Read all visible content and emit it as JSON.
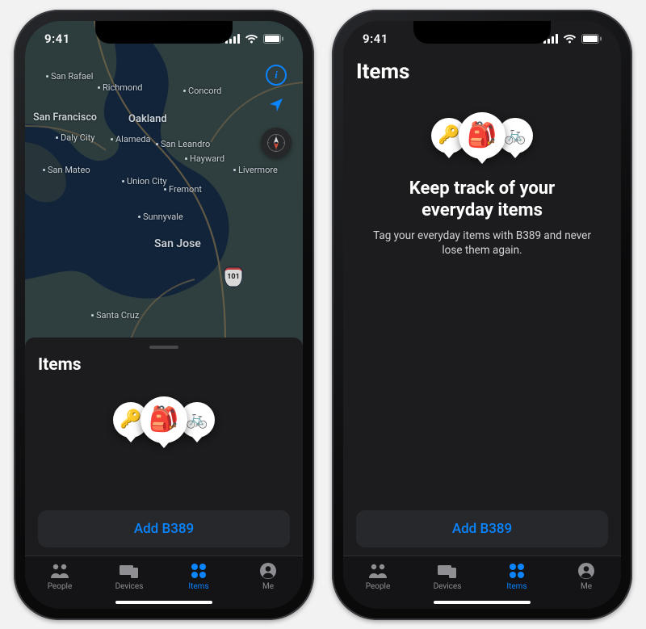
{
  "status": {
    "time": "9:41"
  },
  "map": {
    "labels": {
      "san_rafael": "San Rafael",
      "richmond": "Richmond",
      "concord": "Concord",
      "san_francisco": "San Francisco",
      "oakland": "Oakland",
      "daly_city": "Daly City",
      "alameda": "Alameda",
      "san_leandro": "San Leandro",
      "hayward": "Hayward",
      "san_mateo": "San Mateo",
      "union_city": "Union City",
      "fremont": "Fremont",
      "livermore": "Livermore",
      "sunnyvale": "Sunnyvale",
      "san_jose": "San Jose",
      "santa_cruz": "Santa Cruz"
    },
    "highway_101": "101"
  },
  "left": {
    "sheet_title": "Items",
    "add_button": "Add B389"
  },
  "right": {
    "sheet_title": "Items",
    "icons": {
      "key": "🔑",
      "backpack": "🎒",
      "bike": "🚲"
    },
    "headline_line1": "Keep track of your",
    "headline_line2": "everyday items",
    "subtext": "Tag your everyday items with B389 and never lose them again.",
    "add_button": "Add B389"
  },
  "icons": {
    "key": "🔑",
    "backpack": "🎒",
    "bike": "🚲"
  },
  "tabs": {
    "people": "People",
    "devices": "Devices",
    "items": "Items",
    "me": "Me"
  }
}
